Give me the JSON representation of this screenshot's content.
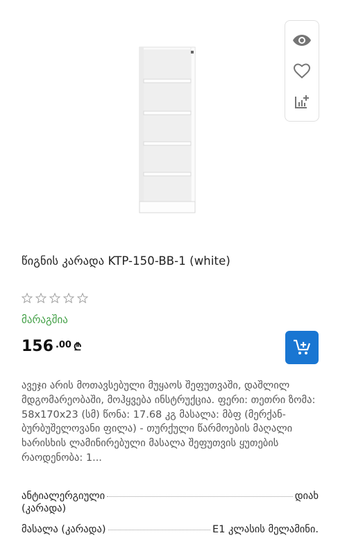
{
  "product": {
    "title": "წიგნის კარადა KTP-150-BB-1 (white)",
    "rating_stars": 0,
    "rating_max": 5,
    "stock_status": "მარაგშია",
    "price_int": "156",
    "price_dec": ".00",
    "currency": "₾",
    "description": "ავეჯი არის მოთავსებული მუყაოს შეფუთვაში, დაშლილ მდგომარეობაში, მოჰყვება ინსტრუქცია. ფერი:  თეთრი ზომა:  58x170x23 (სმ) წონა: 17.68 კგ მასალა:  მბფ (მერქან-ბურბუშელოვანი ფილა) - თურქული წარმოების მაღალი ხარისხის ლამინირებული მასალა შეფუთვის ყუთების რაოდენობა:  1..."
  },
  "specs": [
    {
      "label": "ანტიალერგიული",
      "label_cont": "(კარადა)",
      "value": "დიახ"
    },
    {
      "label": "მასალა (კარადა)",
      "value": "E1 კლასის მელამინი."
    }
  ],
  "icons": {
    "view": "eye-icon",
    "favorite": "heart-icon",
    "compare": "compare-add-icon",
    "cart": "cart-add-icon",
    "star": "star-outline-icon"
  },
  "colors": {
    "accent": "#1976d2",
    "stock": "#43a047",
    "icon_gray": "#757575"
  }
}
